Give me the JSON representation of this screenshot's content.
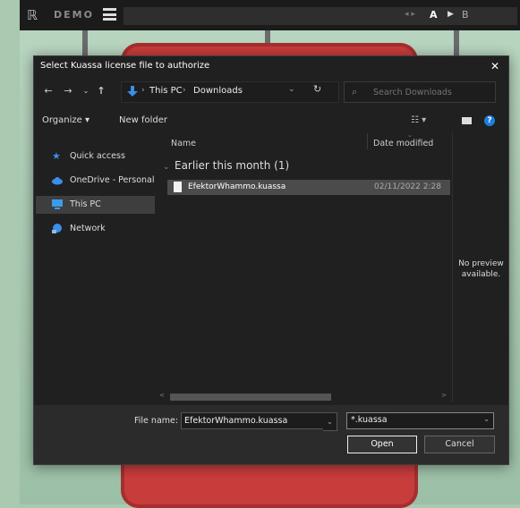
{
  "app": {
    "demo_label": "DEMO",
    "preset_ab": {
      "a_label": "A",
      "b_label": "B"
    }
  },
  "dialog": {
    "title": "Select Kuassa license file to authorize",
    "address": {
      "this_pc": "This PC",
      "folder": "Downloads"
    },
    "search_placeholder": "Search Downloads",
    "toolbar": {
      "organize": "Organize",
      "new_folder": "New folder"
    },
    "sidebar": [
      {
        "label": "Quick access",
        "icon": "star-icon",
        "selected": false
      },
      {
        "label": "OneDrive - Personal",
        "icon": "cloud-icon",
        "selected": false
      },
      {
        "label": "This PC",
        "icon": "monitor-icon",
        "selected": true
      },
      {
        "label": "Network",
        "icon": "network-icon",
        "selected": false
      }
    ],
    "columns": {
      "name": "Name",
      "date_modified": "Date modified"
    },
    "group_header": "Earlier this month (1)",
    "files": [
      {
        "name": "EfektorWhammo.kuassa",
        "date": "02/11/2022 2:28"
      }
    ],
    "preview_text": "No preview\navailable.",
    "file_name_label": "File name:",
    "file_name_value": "EfektorWhammo.kuassa",
    "file_type": "*.kuassa",
    "open_label": "Open",
    "cancel_label": "Cancel"
  },
  "colors": {
    "accent_blue": "#1e7de0",
    "pedal_red": "#c93c3c",
    "background_green": "#a9c9b1"
  }
}
